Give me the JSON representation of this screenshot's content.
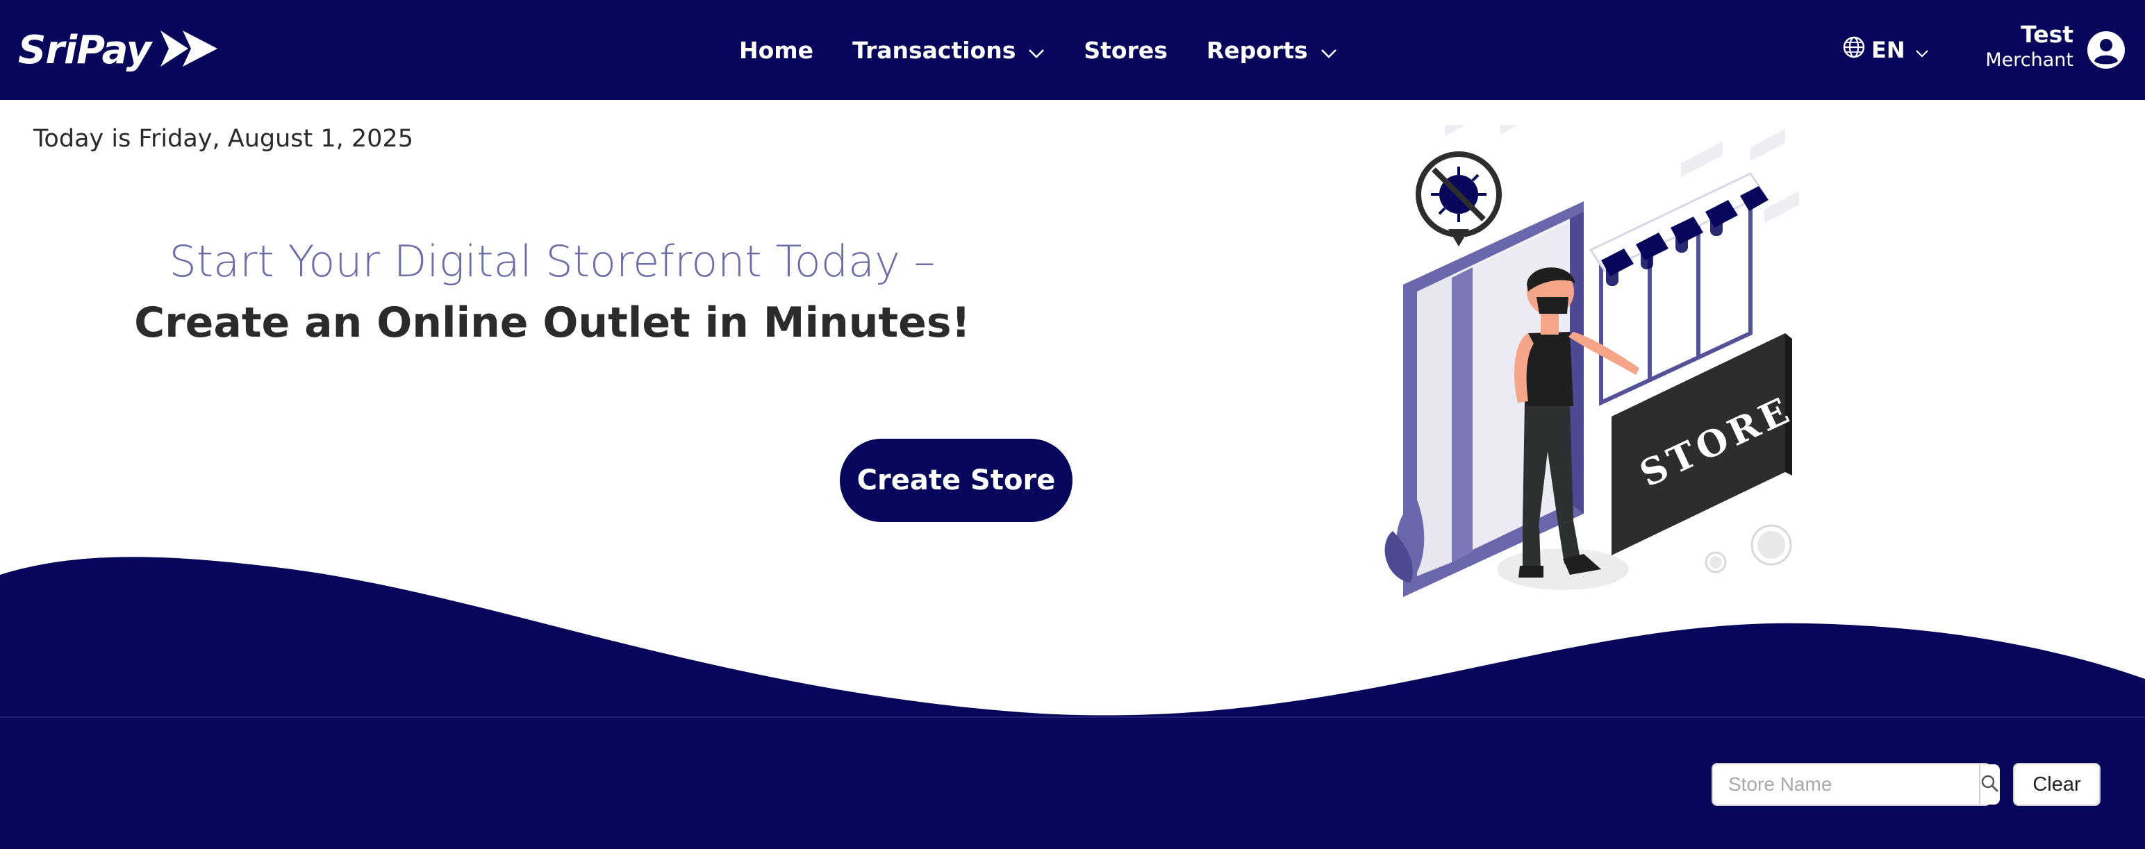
{
  "app": {
    "brand": "SriPay"
  },
  "nav": {
    "items": [
      {
        "label": "Home",
        "has_dropdown": false
      },
      {
        "label": "Transactions",
        "has_dropdown": true
      },
      {
        "label": "Stores",
        "has_dropdown": false
      },
      {
        "label": "Reports",
        "has_dropdown": true
      }
    ]
  },
  "language": {
    "code": "EN",
    "icon": "globe-icon"
  },
  "user": {
    "name": "Test",
    "role": "Merchant",
    "icon": "user-circle-icon"
  },
  "hero": {
    "date_text": "Today is Friday, August 1, 2025",
    "subtitle": "Start Your Digital Storefront Today –",
    "title": "Create an Online Outlet in Minutes!",
    "cta_label": "Create Store",
    "illustration_sign": "STORE"
  },
  "filters": {
    "search_placeholder": "Store Name",
    "search_value": "",
    "search_icon": "search-icon",
    "clear_label": "Clear"
  },
  "colors": {
    "brand_navy": "#06065b",
    "accent_purple": "#6c6ca6",
    "text_dark": "#2b2b2b"
  }
}
